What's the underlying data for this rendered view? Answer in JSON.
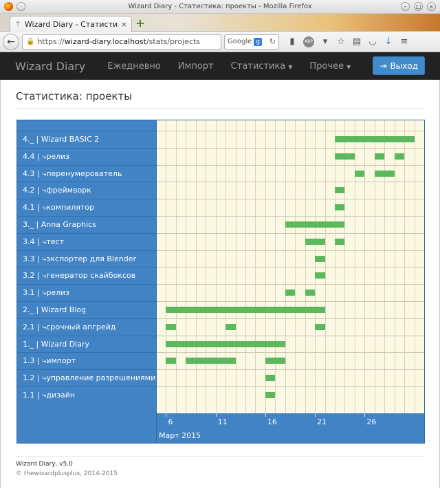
{
  "window": {
    "title": "Wizard Diary - Статистика: проекты - Mozilla Firefox"
  },
  "browser": {
    "tab_label": "Wizard Diary - Статисти...",
    "url_prefix": "https://",
    "url_host": "wizard-diary.localhost",
    "url_path": "/stats/projects",
    "search_engine": "Google",
    "icons": [
      "back-arrow-icon",
      "lock-icon",
      "reload-icon",
      "bookmark-star-icon",
      "reading-list-icon",
      "pocket-icon",
      "download-icon",
      "menu-icon"
    ]
  },
  "navbar": {
    "brand": "Wizard Diary",
    "items": [
      {
        "label": "Ежедневно",
        "dropdown": false
      },
      {
        "label": "Импорт",
        "dropdown": false
      },
      {
        "label": "Статистика",
        "dropdown": true
      },
      {
        "label": "Прочее",
        "dropdown": true
      }
    ],
    "logout_label": "Выход",
    "logout_color": "#428bca"
  },
  "page": {
    "title": "Статистика: проекты"
  },
  "chart_data": {
    "type": "gantt",
    "month_label": "Март 2015",
    "x_ticks": [
      6,
      11,
      16,
      21,
      26
    ],
    "x_range": [
      4,
      31
    ],
    "colors": {
      "bar": "#5cb85c",
      "label_bg": "#4183c4",
      "plot_bg": "#fbf8e3"
    },
    "rows": [
      {
        "label": "4._ | Wizard BASIC 2",
        "spans": [
          [
            22,
            30
          ]
        ]
      },
      {
        "label": "4.4 | ⤷релиз",
        "spans": [
          [
            22,
            24
          ],
          [
            26,
            27
          ],
          [
            28,
            29
          ]
        ]
      },
      {
        "label": "4.3 | ⤷перенумерователь",
        "spans": [
          [
            24,
            25
          ],
          [
            26,
            28
          ]
        ]
      },
      {
        "label": "4.2 | ⤷фреймворк",
        "spans": [
          [
            22,
            23
          ]
        ]
      },
      {
        "label": "4.1 | ⤷компилятор",
        "spans": [
          [
            22,
            23
          ]
        ]
      },
      {
        "label": "3._ | Anna Graphics",
        "spans": [
          [
            17,
            23
          ]
        ]
      },
      {
        "label": "3.4 | ⤷тест",
        "spans": [
          [
            19,
            21
          ],
          [
            22,
            23
          ]
        ]
      },
      {
        "label": "3.3 | ⤷экспортер для Blender",
        "spans": [
          [
            20,
            21
          ]
        ]
      },
      {
        "label": "3.2 | ⤷генератор скайбоксов",
        "spans": [
          [
            20,
            21
          ]
        ]
      },
      {
        "label": "3.1 | ⤷релиз",
        "spans": [
          [
            17,
            18
          ],
          [
            19,
            20
          ]
        ]
      },
      {
        "label": "2._ | Wizard Blog",
        "spans": [
          [
            5,
            21
          ]
        ]
      },
      {
        "label": "2.1 | ⤷срочный апгрейд",
        "spans": [
          [
            5,
            6
          ],
          [
            11,
            12
          ],
          [
            20,
            21
          ]
        ]
      },
      {
        "label": "1._ | Wizard Diary",
        "spans": [
          [
            5,
            17
          ]
        ]
      },
      {
        "label": "1.3 | ⤷импорт",
        "spans": [
          [
            5,
            6
          ],
          [
            7,
            12
          ],
          [
            15,
            17
          ]
        ]
      },
      {
        "label": "1.2 | ⤷управление разрешениями",
        "spans": [
          [
            15,
            16
          ]
        ]
      },
      {
        "label": "1.1 | ⤷дизайн",
        "spans": [
          [
            15,
            16
          ]
        ]
      }
    ]
  },
  "footer": {
    "app_version": "Wizard Diary, v5.0",
    "copyright": "© thewizardplusplus, 2014-2015"
  }
}
